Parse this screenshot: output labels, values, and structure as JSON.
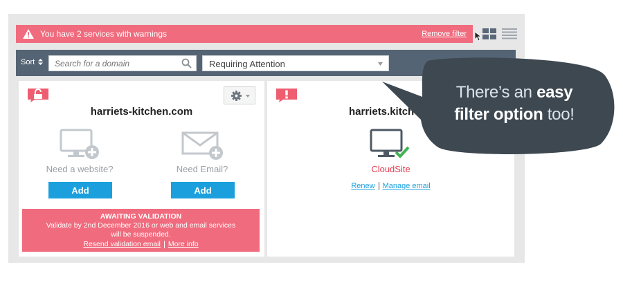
{
  "warning": {
    "text": "You have 2 services with warnings",
    "remove_filter": "Remove filter"
  },
  "toolbar": {
    "sort_label": "Sort",
    "search_placeholder": "Search for a domain",
    "filter_selected": "Requiring Attention"
  },
  "cards": [
    {
      "domain": "harriets-kitchen.com",
      "website_label": "Need a website?",
      "email_label": "Need Email?",
      "add_label": "Add",
      "add_label_2": "Add",
      "validation": {
        "title": "AWAITING VALIDATION",
        "line1": "Validate by 2nd December 2016  or web and email services",
        "line2": "will be suspended.",
        "resend": "Resend validation email",
        "more": "More info"
      }
    },
    {
      "domain": "harriets.kitch",
      "service": "CloudSite",
      "renew": "Renew",
      "manage_email": "Manage email"
    }
  ],
  "callout": {
    "part1": "There’s an ",
    "part2": "easy",
    "part3": "filter option",
    "part4": " too!"
  },
  "colors": {
    "warning_bg": "#f06b7d",
    "toolbar_bg": "#556474",
    "button_blue": "#1ba0dd",
    "status_red": "#e2384d",
    "bubble_bg": "#3d4851"
  }
}
